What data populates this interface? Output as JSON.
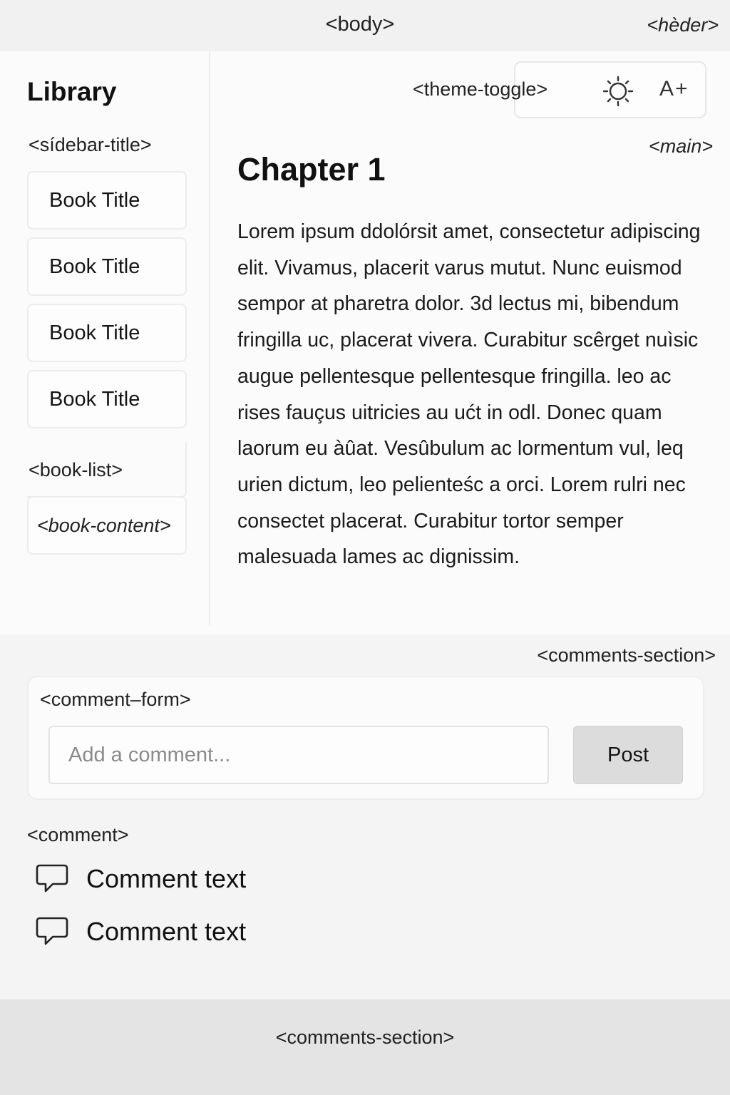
{
  "top_bar": {
    "body_label": "<body>",
    "header_label": "<hèder>"
  },
  "sidebar": {
    "heading": "Library",
    "title_label": "<sídebar-title>",
    "books": [
      "Book Title",
      "Book Title",
      "Book Title",
      "Book Title"
    ],
    "book_list_label": "<book-list>",
    "book_content_label": "<book-content>"
  },
  "main": {
    "theme_toggle_label": "<theme-toggle>",
    "theme_icon": "sun-icon",
    "font_size_label": "A+",
    "label": "<main>",
    "chapter_title": "Chapter 1",
    "chapter_text": "Lorem ipsum ddolórsit amet, consectetur adipiscing elit. Vivamus, placerit varus mutut. Nunc euismod sempor at pharetra dolor. 3d lectus mi, bibendum fringilla uc, placerat vivera. Curabitur scêrget nuìsic augue pellentesque pellentesque fringilla. leo ac rises fauçus uitricies au ućt in odl. Donec quam laorum eu àûat. Vesûbulum ac lormentum vul, leq urien dictum, leo pelienteśc a orci. Lorem rulri nec consectet placerat. Curabitur tortor semper malesuada lames ac dignissim."
  },
  "comments": {
    "section_label": "<comments-section>",
    "form_label": "<comment–form>",
    "input_placeholder": "Add a comment...",
    "post_label": "Post",
    "comment_label": "<comment>",
    "comment_icon": "speech-bubble-icon",
    "items": [
      "Comment text",
      "Comment text"
    ]
  },
  "footer": {
    "label": "<comments-section>"
  },
  "colors": {
    "background": "#f1f1f1",
    "content_background": "#fbfbfb",
    "border": "#ececec",
    "button": "#dcdcdc",
    "footer": "#e4e4e4"
  }
}
